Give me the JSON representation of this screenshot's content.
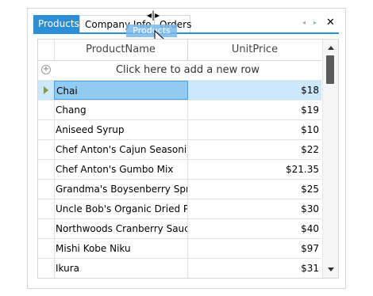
{
  "tabs": [
    {
      "label": "Products",
      "active": true
    },
    {
      "label": "Company Info"
    },
    {
      "label": "Orders"
    }
  ],
  "drag_ghost": {
    "label": "Products"
  },
  "grid": {
    "columns": [
      "ProductName",
      "UnitPrice"
    ],
    "new_row_text": "Click here to add a new row",
    "rows": [
      {
        "name": "Chai",
        "price": "$18",
        "selected": true
      },
      {
        "name": "Chang",
        "price": "$19"
      },
      {
        "name": "Aniseed Syrup",
        "price": "$10"
      },
      {
        "name": "Chef Anton's Cajun Seasoning",
        "price": "$22"
      },
      {
        "name": "Chef Anton's Gumbo Mix",
        "price": "$21.35"
      },
      {
        "name": "Grandma's Boysenberry Spr...",
        "price": "$25"
      },
      {
        "name": "Uncle Bob's Organic Dried P...",
        "price": "$30"
      },
      {
        "name": "Northwoods Cranberry Sauce",
        "price": "$40"
      },
      {
        "name": "Mishi Kobe Niku",
        "price": "$97"
      },
      {
        "name": "Ikura",
        "price": "$31"
      }
    ]
  },
  "icons": {
    "close": "close-icon",
    "scroll_left": "chevron-left-icon",
    "scroll_right": "chevron-right-icon",
    "add": "add-circle-icon",
    "row_indicator": "current-row-arrow-icon",
    "cursor": "mouse-pointer-icon",
    "move": "move-icon",
    "split": "dock-split-icon"
  },
  "colors": {
    "accent": "#2b8fd8",
    "selection": "#cce8fa",
    "selection_cell": "#8fcbf3"
  }
}
